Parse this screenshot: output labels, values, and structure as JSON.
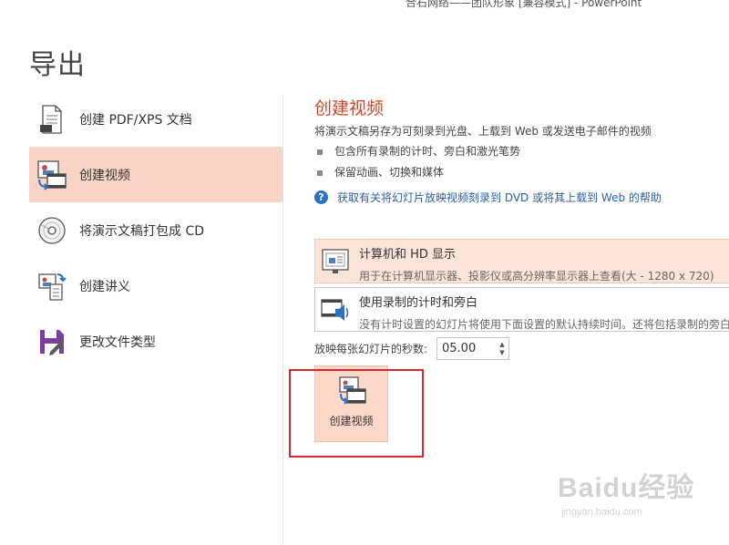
{
  "window": {
    "title": "合石网络——团队形象 [兼容模式] - PowerPoint"
  },
  "page": {
    "heading": "导出"
  },
  "menu": {
    "items": [
      {
        "label": "创建 PDF/XPS 文档",
        "icon": "pdf-document-icon"
      },
      {
        "label": "创建视频",
        "icon": "video-icon",
        "selected": true
      },
      {
        "label": "将演示文稿打包成 CD",
        "icon": "cd-icon"
      },
      {
        "label": "创建讲义",
        "icon": "handout-icon"
      },
      {
        "label": "更改文件类型",
        "icon": "save-file-type-icon"
      }
    ]
  },
  "content": {
    "title": "创建视频",
    "description": "将演示文稿另存为可刻录到光盘、上载到 Web 或发送电子邮件的视频",
    "bullets": [
      "包含所有录制的计时、旁白和激光笔势",
      "保留动画、切换和媒体"
    ],
    "help_link": "获取有关将幻灯片放映视频刻录到 DVD 或将其上载到 Web 的帮助",
    "quality_dropdown": {
      "title": "计算机和 HD 显示",
      "subtitle": "用于在计算机显示器、投影仪或高分辨率显示器上查看(大 - 1280 x 720)"
    },
    "timing_dropdown": {
      "title": "使用录制的计时和旁白",
      "subtitle": "没有计时设置的幻灯片将使用下面设置的默认持续时间。还将包括录制的旁白"
    },
    "seconds_label": "放映每张幻灯片的秒数:",
    "seconds_value": "05.00",
    "create_button": "创建视频"
  },
  "watermark": {
    "main": "Baidu经验",
    "sub": "jingyan.baidu.com"
  },
  "colors": {
    "accent": "#d24726",
    "selected_bg": "#f9d4c4",
    "link": "#2a5fa5",
    "highlight_box": "#d9262f"
  }
}
